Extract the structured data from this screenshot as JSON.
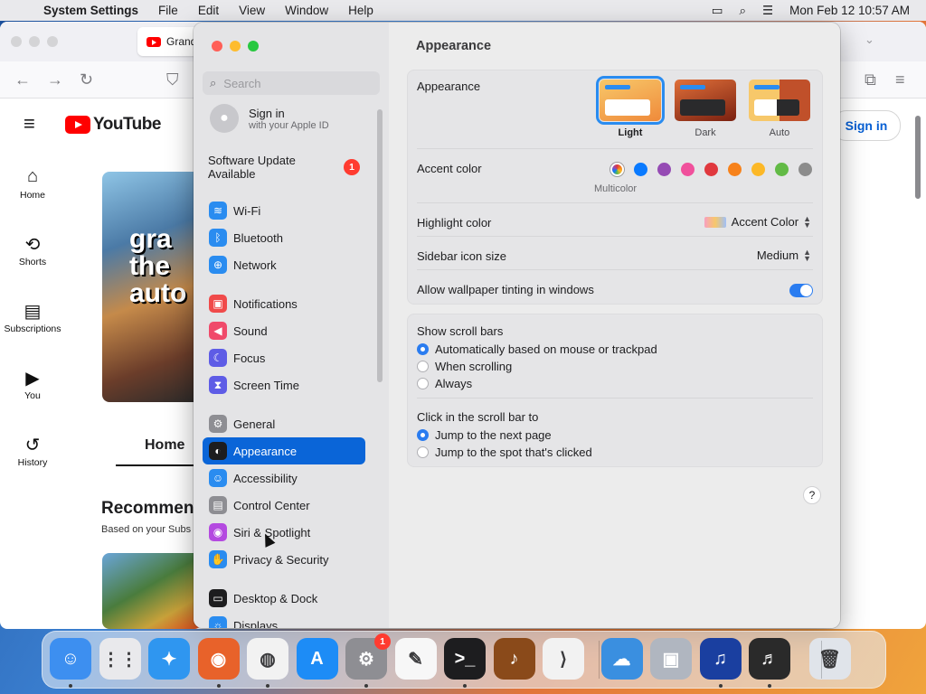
{
  "menubar": {
    "app": "System Settings",
    "items": [
      "File",
      "Edit",
      "View",
      "Window",
      "Help"
    ],
    "datetime": "Mon Feb 12  10:57 AM"
  },
  "browser": {
    "tab_title": "Grand",
    "youtube": {
      "logo": "YouTube",
      "sidebar": [
        "Home",
        "Shorts",
        "Subscriptions",
        "You",
        "History"
      ],
      "sign_in": "Sign in",
      "thumb_text": "gra\nthe\nauto",
      "home_tab": "Home",
      "recommended": "Recommen",
      "subtitle": "Based on your Subs"
    }
  },
  "settings": {
    "search_placeholder": "Search",
    "account": {
      "title": "Sign in",
      "subtitle": "with your Apple ID"
    },
    "update": {
      "label_line1": "Software Update",
      "label_line2": "Available",
      "badge": "1"
    },
    "sidebar": [
      {
        "label": "Wi-Fi",
        "color": "#2a8cf0",
        "glyph": "≋"
      },
      {
        "label": "Bluetooth",
        "color": "#2a8cf0",
        "glyph": "ᛒ"
      },
      {
        "label": "Network",
        "color": "#2a8cf0",
        "glyph": "⊕"
      },
      {
        "label": "Notifications",
        "color": "#f04a4a",
        "glyph": "▣"
      },
      {
        "label": "Sound",
        "color": "#f04a6a",
        "glyph": "◀"
      },
      {
        "label": "Focus",
        "color": "#5e5ce6",
        "glyph": "☾"
      },
      {
        "label": "Screen Time",
        "color": "#5e5ce6",
        "glyph": "⧗"
      },
      {
        "label": "General",
        "color": "#8e8e93",
        "glyph": "⚙"
      },
      {
        "label": "Appearance",
        "color": "#1d1d1f",
        "glyph": "◐"
      },
      {
        "label": "Accessibility",
        "color": "#2a8cf0",
        "glyph": "☺"
      },
      {
        "label": "Control Center",
        "color": "#8e8e93",
        "glyph": "▤"
      },
      {
        "label": "Siri & Spotlight",
        "color": "#b44ae0",
        "glyph": "◉"
      },
      {
        "label": "Privacy & Security",
        "color": "#2a8cf0",
        "glyph": "✋"
      },
      {
        "label": "Desktop & Dock",
        "color": "#1d1d1f",
        "glyph": "▭"
      },
      {
        "label": "Displays",
        "color": "#2a8cf0",
        "glyph": "☼"
      }
    ],
    "selected": "Appearance",
    "content": {
      "title": "Appearance",
      "appearance_label": "Appearance",
      "modes": [
        "Light",
        "Dark",
        "Auto"
      ],
      "selected_mode": "Light",
      "accent_label": "Accent color",
      "accent_colors": [
        "#bbbbbb",
        "#0a7aff",
        "#954bb4",
        "#f0509c",
        "#e0383e",
        "#f7821b",
        "#fcb827",
        "#62ba46",
        "#8c8c8c"
      ],
      "accent_selected_name": "Multicolor",
      "highlight_label": "Highlight color",
      "highlight_value": "Accent Color",
      "icon_size_label": "Sidebar icon size",
      "icon_size_value": "Medium",
      "tinting_label": "Allow wallpaper tinting in windows",
      "tinting_on": true,
      "scrollbars_label": "Show scroll bars",
      "scrollbar_options": [
        "Automatically based on mouse or trackpad",
        "When scrolling",
        "Always"
      ],
      "scrollbar_selected": 0,
      "click_label": "Click in the scroll bar to",
      "click_options": [
        "Jump to the next page",
        "Jump to the spot that's clicked"
      ],
      "click_selected": 0,
      "help": "?"
    }
  },
  "dock": {
    "apps": [
      {
        "name": "Finder",
        "color": "#3d8ff0",
        "glyph": "☺"
      },
      {
        "name": "Launchpad",
        "color": "#e9e9ec",
        "glyph": "⋮⋮"
      },
      {
        "name": "Safari",
        "color": "#2f96f0",
        "glyph": "✦"
      },
      {
        "name": "Firefox",
        "color": "#e8622a",
        "glyph": "◉"
      },
      {
        "name": "Chrome",
        "color": "#f2f2f2",
        "glyph": "◍"
      },
      {
        "name": "App Store",
        "color": "#1d8cf6",
        "glyph": "A"
      },
      {
        "name": "System Settings",
        "color": "#8e8e93",
        "glyph": "⚙"
      },
      {
        "name": "TextEdit",
        "color": "#f7f7f7",
        "glyph": "✎"
      },
      {
        "name": "Terminal",
        "color": "#1d1d1f",
        "glyph": ">_"
      },
      {
        "name": "GarageBand",
        "color": "#8a4a1a",
        "glyph": "♪"
      },
      {
        "name": "VS Code",
        "color": "#f2f2f2",
        "glyph": "⟩"
      },
      {
        "name": "Weather",
        "color": "#3a8fe0",
        "glyph": "☁"
      },
      {
        "name": "Preview",
        "color": "#b0b6c0",
        "glyph": "▣"
      },
      {
        "name": "Audacity",
        "color": "#1a3fa0",
        "glyph": "♫"
      },
      {
        "name": "Piano",
        "color": "#2a2a2a",
        "glyph": "♬"
      },
      {
        "name": "Trash",
        "color": "#e0e4ea",
        "glyph": "🗑"
      }
    ],
    "settings_badge": "1"
  }
}
